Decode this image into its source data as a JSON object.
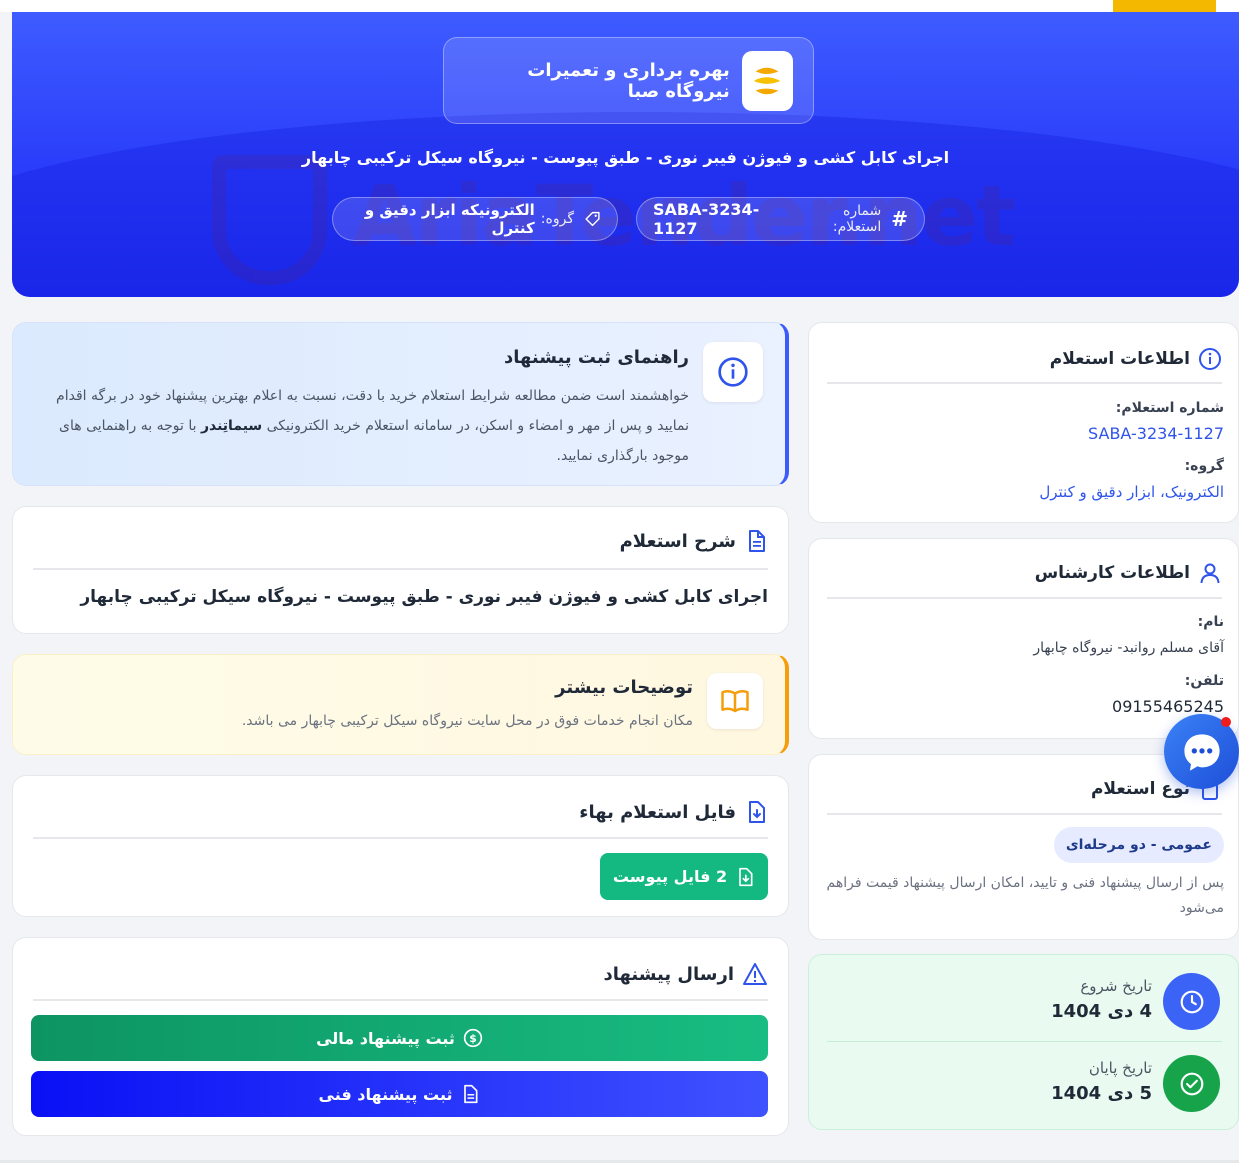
{
  "company": {
    "name": "بهره برداری و تعمیرات نیروگاه صبا"
  },
  "tender": {
    "title": "اجرای کابل کشی و فیوژن فیبر نوری - طبق پیوست - نیروگاه سیکل ترکیبی چابهار",
    "number_label": "شماره استعلام:",
    "number": "SABA-3234-1127",
    "group_label": "گروه:",
    "group": "الکترونیکه ابزار دقیق و کنترل"
  },
  "watermark": {
    "text": "AriaTender.net"
  },
  "guide": {
    "title": "راهنمای ثبت پیشنهاد",
    "text_part1": "خواهشمند است ضمن مطالعه شرایط استعلام خرید با دقت، نسبت به اعلام بهترین پیشنهاد خود در برگه اقدام نمایید و پس از مهر و امضاء و اسکن، در سامانه استعلام خرید الکترونیکی ",
    "brand": "سیماتِندر",
    "text_part2": " با توجه به راهنمایی های موجود بارگذاری نمایید."
  },
  "description": {
    "title": "شرح استعلام",
    "text": "اجرای کابل کشی و فیوژن فیبر نوری - طبق پیوست - نیروگاه سیکل ترکیبی چابهار"
  },
  "more_info": {
    "title": "توضیحات بیشتر",
    "text": "مکان انجام خدمات فوق در محل سایت نیروگاه سیکل ترکیبی چابهار می باشد."
  },
  "files": {
    "title": "فایل استعلام بهاء",
    "button": "2 فایل پیوست"
  },
  "submit": {
    "title": "ارسال پیشنهاد",
    "financial": "ثبت پیشنهاد مالی",
    "technical": "ثبت پیشنهاد فنی"
  },
  "info_card": {
    "title": "اطلاعات استعلام",
    "number_label": "شماره استعلام:",
    "number": "SABA-3234-1127",
    "group_label": "گروه:",
    "group": "الکترونیک، ابزار دقیق و کنترل"
  },
  "expert_card": {
    "title": "اطلاعات کارشناس",
    "name_label": "نام:",
    "name": "آقای مسلم روانبد- نیروگاه چابهار",
    "phone_label": "تلفن:",
    "phone": "09155465245"
  },
  "type_card": {
    "title": "نوع استعلام",
    "badge": "عمومی - دو مرحله‌ای",
    "text": "پس از ارسال پیشنهاد فنی و تایید، امکان ارسال پیشنهاد قیمت فراهم می‌شود"
  },
  "dates": {
    "start_label": "تاریخ شروع",
    "start": "4 دی 1404",
    "end_label": "تاریخ پایان",
    "end": "5 دی 1404"
  },
  "colors": {
    "brand_blue": "#2a3dfa",
    "green": "#10b981",
    "amber": "#f59e0b",
    "link": "#2f54eb"
  }
}
